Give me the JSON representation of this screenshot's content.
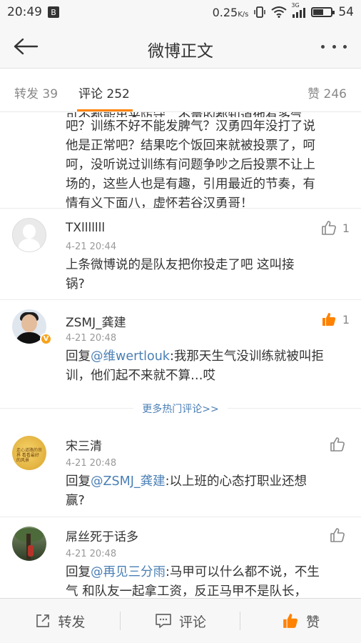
{
  "status_bar": {
    "time": "20:49",
    "app_icon_text": "B",
    "net_speed": "0.25",
    "net_unit": "K/s",
    "signal": "3G",
    "battery": "54",
    "battery_level": 0.54
  },
  "nav": {
    "title": "微博正文"
  },
  "tabs": {
    "repost": "转发 39",
    "comments": "评论 252",
    "likes": "赞 246"
  },
  "partial_comment": {
    "lines": [
      "吧？训练不好不能发脾气？汉勇四年没打了说",
      "他是正常吧？结果吃个饭回来就被投票了，呵",
      "呵，没听说过训练有问题争吵之后投票不让上",
      "场的，这些人也是有趣，引用最近的节奏，有",
      "情有义下面八，虚怀若谷汉勇哥！"
    ]
  },
  "comments": [
    {
      "name": "TXlllllll",
      "time": "4-21 20:44",
      "text_lines": [
        "上条微博说的是队友把你投走了吧 这叫接",
        "锅?"
      ],
      "likes": "1"
    },
    {
      "name": "ZSMJ_龚建",
      "time": "4-21 20:48",
      "reply_prefix": "回复",
      "mention": "@维wertlouk",
      "text_lines": [
        ":我那天生气没训练就被叫拒",
        "训，他们起不来就不算…哎"
      ],
      "likes": "1",
      "verified_badge": "V"
    },
    {
      "name": "宋三清",
      "time": "4-21 20:48",
      "reply_prefix": "回复",
      "mention": "@ZSMJ_龚建",
      "text_lines": [
        ":以上班的心态打职业还想",
        "赢?"
      ],
      "avatar_text": "走心道路的世界 看看最好的风景"
    },
    {
      "name": "屌丝死于话多",
      "time": "4-21 20:48",
      "reply_prefix": "回复",
      "mention": "@再见三分雨",
      "text_lines": [
        ":马甲可以什么都不说，不生",
        "气 和队友一起拿工资，反正马甲不是队长，"
      ]
    }
  ],
  "more_hot": "更多热门评论>>",
  "bottom_bar": {
    "repost": "转发",
    "comment": "评论",
    "like": "赞"
  },
  "colors": {
    "accent": "#ff8200",
    "link": "#4a7fb5"
  }
}
